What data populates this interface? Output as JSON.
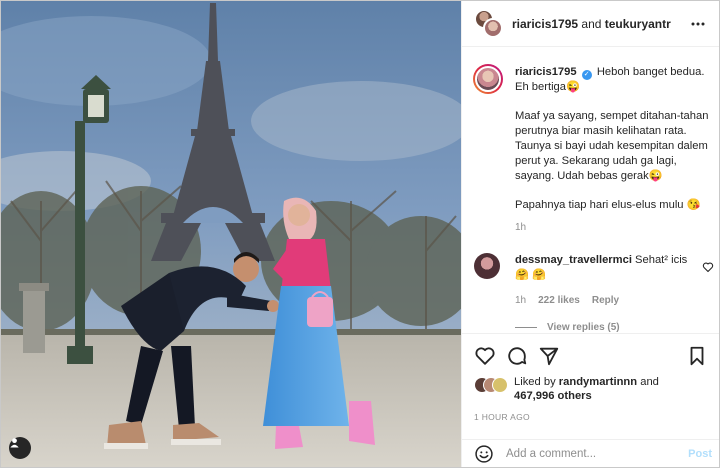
{
  "header": {
    "username_1": "riaricis1795",
    "joiner": " and ",
    "username_2": "teukuryantr"
  },
  "caption": {
    "username": "riaricis1795",
    "line_1": "Heboh banget bedua. Eh bertiga",
    "line_1_emoji": "😜",
    "para_2": "Maaf ya sayang, sempet ditahan-tahan perutnya biar masih kelihatan rata. Taunya si bayi udah kesempitan dalem perut ya. Sekarang udah ga lagi, sayang. Udah bebas gerak",
    "para_2_emoji": "😜",
    "para_3": "Papahnya tiap hari elus-elus mulu",
    "para_3_emoji": "😘",
    "time": "1h"
  },
  "comment": {
    "username": "dessmay_travellermci",
    "text": "Sehat² icis",
    "emoji_1": "🤗",
    "emoji_2": "🤗",
    "time": "1h",
    "likes": "222 likes",
    "reply": "Reply",
    "view_replies": "View replies (5)"
  },
  "likes": {
    "prefix": "Liked by ",
    "user": "randymartinnn",
    "middle": " and",
    "count": "467,996 others"
  },
  "post_time": "1 HOUR AGO",
  "add_comment": {
    "placeholder": "Add a comment...",
    "post_label": "Post"
  },
  "colors": {
    "accent_blue": "#3897f0",
    "post_button": "#b2dffc",
    "secondary_text": "#8e8e8e"
  },
  "icons": [
    "more-icon",
    "heart-icon",
    "comment-icon",
    "share-icon",
    "bookmark-icon",
    "emoji-icon",
    "user-tag-icon",
    "verified-icon"
  ]
}
